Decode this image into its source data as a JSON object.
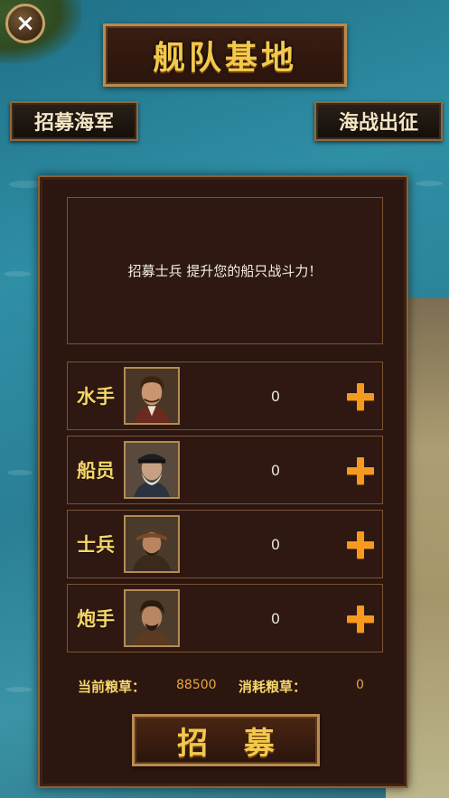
{
  "header": {
    "close_icon": "×",
    "title": "舰队基地",
    "recruit_navy_label": "招募海军",
    "sea_battle_label": "海战出征"
  },
  "panel": {
    "info_text": "招募士兵 提升您的船只战斗力！",
    "units": [
      {
        "label": "水手",
        "count": "0",
        "avatar": "sailor-portrait"
      },
      {
        "label": "船员",
        "count": "0",
        "avatar": "crewman-portrait"
      },
      {
        "label": "士兵",
        "count": "0",
        "avatar": "soldier-portrait"
      },
      {
        "label": "炮手",
        "count": "0",
        "avatar": "gunner-portrait"
      }
    ],
    "food": {
      "current_label": "当前粮草：",
      "current_value": "88500",
      "consume_label": "消耗粮草：",
      "consume_value": "0"
    },
    "recruit_button": "招 募"
  },
  "colors": {
    "title_gold": "#f2c94c",
    "label_gold": "#f6d76a",
    "plus_orange": "#f59a1f",
    "panel_bg": "#2b1610"
  }
}
